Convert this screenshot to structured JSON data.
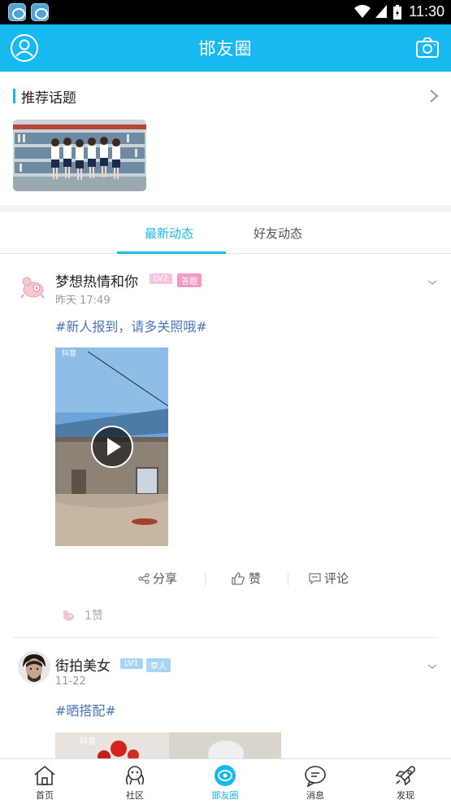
{
  "status_bar": {
    "time": "11:30",
    "app_icons": [
      "app-notification-icon",
      "app-notification-icon"
    ]
  },
  "header": {
    "title": "邯友圈",
    "left_icon": "profile-icon",
    "right_icon": "camera-icon"
  },
  "topics": {
    "heading": "推荐话题",
    "more_icon": "chevron-right-icon"
  },
  "tabs": [
    {
      "label": "最新动态",
      "active": true
    },
    {
      "label": "好友动态",
      "active": false
    }
  ],
  "posts": [
    {
      "username": "梦想热情和你",
      "level": "LV2",
      "tag": "答题",
      "time": "昨天 17:49",
      "hashtag": "#新人报到，请多关照哦#",
      "video_watermark": "抖音",
      "actions": {
        "share": "分享",
        "like": "赞",
        "comment": "评论"
      },
      "likes": "1赞"
    },
    {
      "username": "街拍美女",
      "level": "LV1",
      "tag": "草人",
      "time": "11-22",
      "hashtag": "#晒搭配#",
      "video_watermark": "抖音"
    }
  ],
  "bottom_nav": [
    {
      "label": "首页",
      "icon": "home-icon",
      "active": false
    },
    {
      "label": "社区",
      "icon": "community-icon",
      "active": false
    },
    {
      "label": "邯友圈",
      "icon": "circle-icon",
      "active": true
    },
    {
      "label": "消息",
      "icon": "message-icon",
      "active": false
    },
    {
      "label": "发现",
      "icon": "rocket-icon",
      "active": false
    }
  ],
  "colors": {
    "accent": "#16b9f0",
    "hashtag": "#4a76b8",
    "lv2_badge": "#f7b9d8",
    "lv1_badge": "#a8d4f5"
  }
}
